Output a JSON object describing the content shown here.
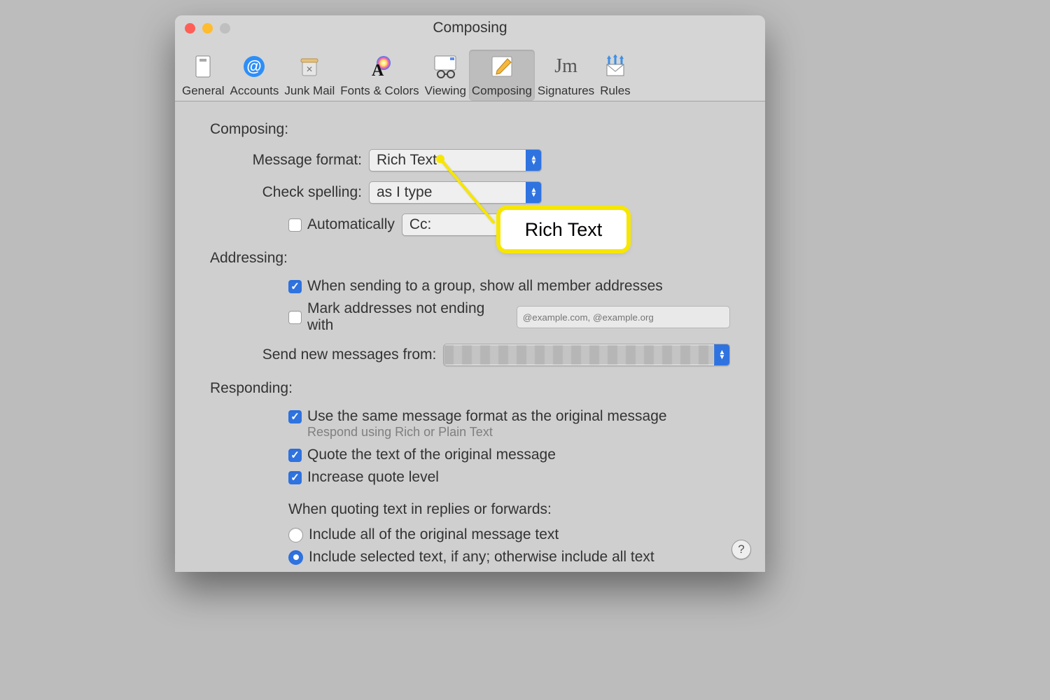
{
  "window": {
    "title": "Composing"
  },
  "toolbar": {
    "items": [
      {
        "label": "General"
      },
      {
        "label": "Accounts"
      },
      {
        "label": "Junk Mail"
      },
      {
        "label": "Fonts & Colors"
      },
      {
        "label": "Viewing"
      },
      {
        "label": "Composing"
      },
      {
        "label": "Signatures"
      },
      {
        "label": "Rules"
      }
    ],
    "selected_index": 5
  },
  "composing": {
    "section_label": "Composing:",
    "message_format": {
      "label": "Message format:",
      "value": "Rich Text"
    },
    "check_spelling": {
      "label": "Check spelling:",
      "value": "as I type"
    },
    "auto_cc": {
      "label": "Automatically",
      "field_value": "Cc:",
      "checked": false
    }
  },
  "addressing": {
    "section_label": "Addressing:",
    "group_all_members": {
      "label": "When sending to a group, show all member addresses",
      "checked": true
    },
    "mark_addresses": {
      "label": "Mark addresses not ending with",
      "placeholder": "@example.com, @example.org",
      "checked": false
    },
    "send_from": {
      "label": "Send new messages from:"
    }
  },
  "responding": {
    "section_label": "Responding:",
    "same_format": {
      "label": "Use the same message format as the original message",
      "sub": "Respond using Rich or Plain Text",
      "checked": true
    },
    "quote_text": {
      "label": "Quote the text of the original message",
      "checked": true
    },
    "increase_quote": {
      "label": "Increase quote level",
      "checked": true
    },
    "quoting_when_label": "When quoting text in replies or forwards:",
    "include_all": {
      "label": "Include all of the original message text",
      "checked": false
    },
    "include_selected": {
      "label": "Include selected text, if any; otherwise include all text",
      "checked": true
    }
  },
  "callout": {
    "text": "Rich Text"
  },
  "help_label": "?"
}
